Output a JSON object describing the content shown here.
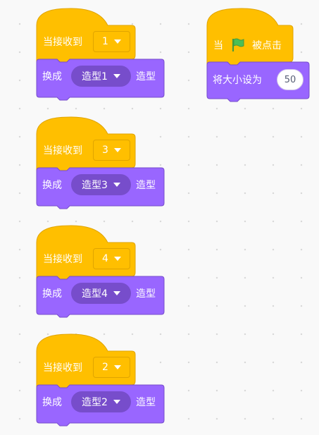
{
  "colors": {
    "events": "#ffbf00",
    "events_border": "#e0a400",
    "looks": "#9966ff",
    "looks_border": "#774dcb",
    "flag": "#4cbf56"
  },
  "scripts": [
    {
      "hat_label": "当接收到",
      "message": "1",
      "action_label": "换成",
      "costume": "造型1",
      "suffix": "造型"
    },
    {
      "hat_label": "当接收到",
      "message": "3",
      "action_label": "换成",
      "costume": "造型3",
      "suffix": "造型"
    },
    {
      "hat_label": "当接收到",
      "message": "4",
      "action_label": "换成",
      "costume": "造型4",
      "suffix": "造型"
    },
    {
      "hat_label": "当接收到",
      "message": "2",
      "action_label": "换成",
      "costume": "造型2",
      "suffix": "造型"
    }
  ],
  "flag_script": {
    "hat_prefix": "当",
    "flag_icon": "green-flag-icon",
    "hat_suffix": "被点击",
    "action_label": "将大小设为",
    "size_value": "50"
  }
}
